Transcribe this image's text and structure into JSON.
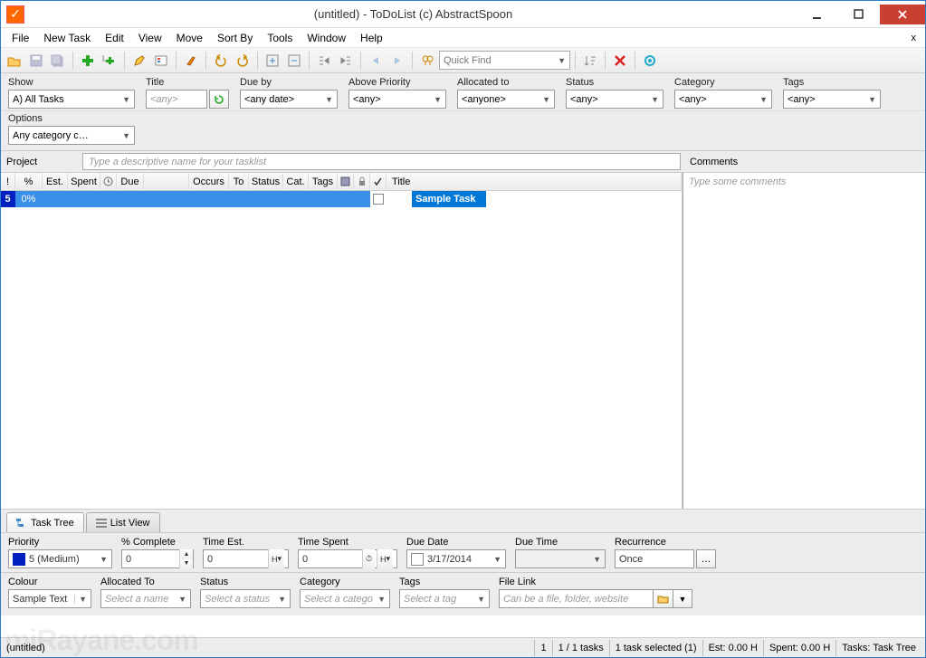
{
  "window": {
    "title": "(untitled) - ToDoList (c) AbstractSpoon"
  },
  "menu": {
    "file": "File",
    "new_task": "New Task",
    "edit": "Edit",
    "view": "View",
    "move": "Move",
    "sort_by": "Sort By",
    "tools": "Tools",
    "window": "Window",
    "help": "Help",
    "close_x": "x"
  },
  "quickfind": {
    "placeholder": "Quick Find"
  },
  "filters": {
    "show": {
      "label": "Show",
      "value": "A)  All Tasks"
    },
    "title": {
      "label": "Title",
      "placeholder": "<any>"
    },
    "due_by": {
      "label": "Due by",
      "value": "<any date>"
    },
    "above_priority": {
      "label": "Above Priority",
      "value": "<any>"
    },
    "allocated_to": {
      "label": "Allocated to",
      "value": "<anyone>"
    },
    "status": {
      "label": "Status",
      "value": "<any>"
    },
    "category": {
      "label": "Category",
      "value": "<any>"
    },
    "tags": {
      "label": "Tags",
      "value": "<any>"
    },
    "options": {
      "label": "Options",
      "value": "Any category c…"
    }
  },
  "project": {
    "label": "Project",
    "placeholder": "Type a descriptive name for your tasklist"
  },
  "comments": {
    "label": "Comments",
    "placeholder": "Type some comments"
  },
  "grid": {
    "headers": {
      "bang": "!",
      "pct": "%",
      "est": "Est.",
      "spent": "Spent",
      "clock": "⏱",
      "due": "Due",
      "occurs": "Occurs",
      "to": "To",
      "status": "Status",
      "cat": "Cat.",
      "tags": "Tags",
      "disk": "▦",
      "lock": "🔒",
      "check": "✔",
      "title": "Title"
    },
    "row": {
      "priority": "5",
      "pct": "0%",
      "title": "Sample Task"
    }
  },
  "tabs": {
    "tree": "Task Tree",
    "list": "List View"
  },
  "attrs": {
    "priority": {
      "label": "Priority",
      "value": "5 (Medium)"
    },
    "pct_complete": {
      "label": "% Complete",
      "value": "0"
    },
    "time_est": {
      "label": "Time Est.",
      "value": "0",
      "unit": "H"
    },
    "time_spent": {
      "label": "Time Spent",
      "value": "0",
      "unit": "H"
    },
    "due_date": {
      "label": "Due Date",
      "value": "3/17/2014"
    },
    "due_time": {
      "label": "Due Time",
      "value": ""
    },
    "recurrence": {
      "label": "Recurrence",
      "value": "Once"
    },
    "colour": {
      "label": "Colour",
      "value": "Sample Text"
    },
    "allocated_to": {
      "label": "Allocated To",
      "placeholder": "Select a name"
    },
    "status": {
      "label": "Status",
      "placeholder": "Select a status"
    },
    "category": {
      "label": "Category",
      "placeholder": "Select a catego"
    },
    "tags": {
      "label": "Tags",
      "placeholder": "Select a tag"
    },
    "file_link": {
      "label": "File Link",
      "placeholder": "Can be a file, folder, website"
    }
  },
  "status": {
    "doc": "(untitled)",
    "page": "1",
    "tasks": "1 / 1 tasks",
    "selected": "1 task selected (1)",
    "est": "Est: 0.00 H",
    "spent": "Spent: 0.00 H",
    "view": "Tasks: Task Tree"
  },
  "watermark": "miRayane.com"
}
